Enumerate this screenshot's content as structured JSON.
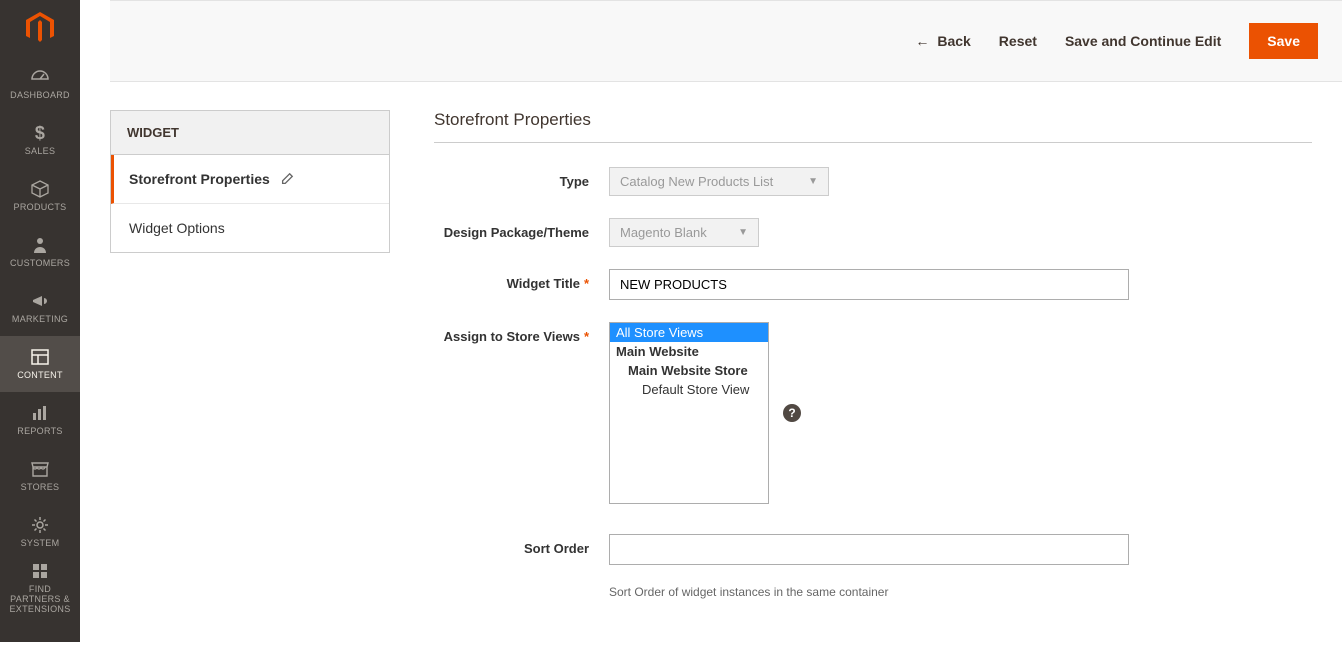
{
  "sidebar": {
    "items": [
      {
        "id": "dashboard",
        "label": "DASHBOARD",
        "icon": "dashboard"
      },
      {
        "id": "sales",
        "label": "SALES",
        "icon": "dollar"
      },
      {
        "id": "products",
        "label": "PRODUCTS",
        "icon": "box"
      },
      {
        "id": "customers",
        "label": "CUSTOMERS",
        "icon": "person"
      },
      {
        "id": "marketing",
        "label": "MARKETING",
        "icon": "megaphone"
      },
      {
        "id": "content",
        "label": "CONTENT",
        "icon": "layout",
        "active": true
      },
      {
        "id": "reports",
        "label": "REPORTS",
        "icon": "bars"
      },
      {
        "id": "stores",
        "label": "STORES",
        "icon": "storefront"
      },
      {
        "id": "system",
        "label": "SYSTEM",
        "icon": "gear"
      },
      {
        "id": "partners",
        "label": "FIND PARTNERS & EXTENSIONS",
        "icon": "blocks"
      }
    ]
  },
  "actions": {
    "back": "Back",
    "reset": "Reset",
    "save_continue": "Save and Continue Edit",
    "save": "Save"
  },
  "sidepanel": {
    "heading": "WIDGET",
    "tabs": [
      {
        "id": "storefront",
        "label": "Storefront Properties",
        "active": true,
        "editable": true
      },
      {
        "id": "options",
        "label": "Widget Options"
      }
    ]
  },
  "form": {
    "section_title": "Storefront Properties",
    "type": {
      "label": "Type",
      "value": "Catalog New Products List"
    },
    "theme": {
      "label": "Design Package/Theme",
      "value": "Magento Blank"
    },
    "title": {
      "label": "Widget Title",
      "value": "NEW PRODUCTS"
    },
    "stores": {
      "label": "Assign to Store Views",
      "options": [
        {
          "text": "All Store Views",
          "selected": true
        },
        {
          "text": "Main Website",
          "bold": true
        },
        {
          "text": "Main Website Store",
          "bold": true,
          "indent": 1
        },
        {
          "text": "Default Store View",
          "indent": 2
        }
      ]
    },
    "sort": {
      "label": "Sort Order",
      "value": "",
      "hint": "Sort Order of widget instances in the same container"
    }
  }
}
